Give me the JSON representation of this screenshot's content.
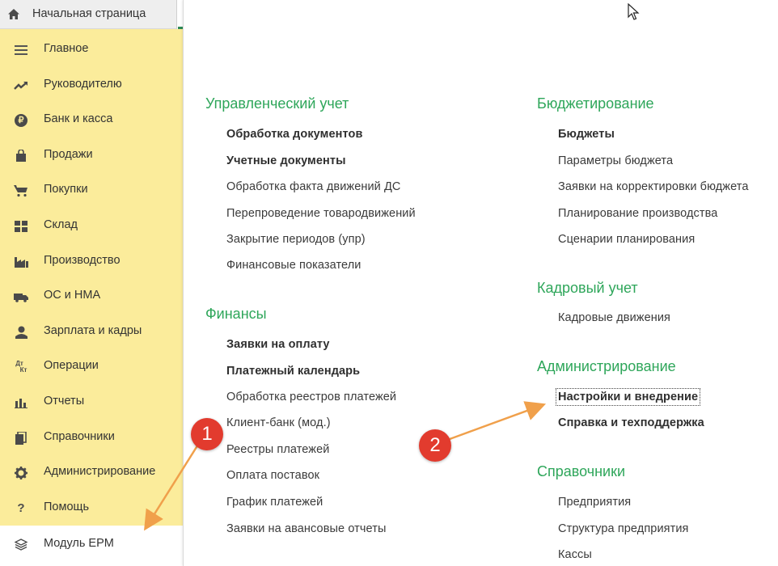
{
  "header": {
    "home_tab_label": "Начальная страница"
  },
  "sidebar": {
    "items": [
      {
        "label": "Главное",
        "icon": "menu-lines-icon"
      },
      {
        "label": "Руководителю",
        "icon": "trend-up-icon"
      },
      {
        "label": "Банк и касса",
        "icon": "ruble-coin-icon"
      },
      {
        "label": "Продажи",
        "icon": "shopping-bag-icon"
      },
      {
        "label": "Покупки",
        "icon": "cart-icon"
      },
      {
        "label": "Склад",
        "icon": "warehouse-grid-icon"
      },
      {
        "label": "Производство",
        "icon": "factory-icon"
      },
      {
        "label": "ОС и НМА",
        "icon": "truck-icon"
      },
      {
        "label": "Зарплата и кадры",
        "icon": "person-icon"
      },
      {
        "label": "Операции",
        "icon": "debit-credit-icon"
      },
      {
        "label": "Отчеты",
        "icon": "bar-chart-icon"
      },
      {
        "label": "Справочники",
        "icon": "books-icon"
      },
      {
        "label": "Администрирование",
        "icon": "gear-icon"
      },
      {
        "label": "Помощь",
        "icon": "question-icon"
      },
      {
        "label": "Модуль EPM",
        "icon": "cube-stack-icon"
      }
    ],
    "icon_text": {
      "ruble": "₽",
      "debit_credit_top": "Дт",
      "debit_credit_bottom": "Кт",
      "question": "?"
    }
  },
  "panel": {
    "left": [
      {
        "title": "Управленческий учет",
        "links": [
          {
            "label": "Обработка документов",
            "bold": true
          },
          {
            "label": "Учетные документы",
            "bold": true
          },
          {
            "label": "Обработка факта движений ДС",
            "bold": false
          },
          {
            "label": "Перепроведение товародвижений",
            "bold": false
          },
          {
            "label": "Закрытие периодов (упр)",
            "bold": false
          },
          {
            "label": "Финансовые показатели",
            "bold": false
          }
        ]
      },
      {
        "title": "Финансы",
        "links": [
          {
            "label": "Заявки на оплату",
            "bold": true
          },
          {
            "label": "Платежный календарь",
            "bold": true
          },
          {
            "label": "Обработка реестров платежей",
            "bold": false
          },
          {
            "label": "Клиент-банк (мод.)",
            "bold": false
          },
          {
            "label": "Реестры платежей",
            "bold": false
          },
          {
            "label": "Оплата поставок",
            "bold": false
          },
          {
            "label": "График платежей",
            "bold": false
          },
          {
            "label": "Заявки на авансовые отчеты",
            "bold": false
          }
        ]
      }
    ],
    "right": [
      {
        "title": "Бюджетирование",
        "links": [
          {
            "label": "Бюджеты",
            "bold": true
          },
          {
            "label": "Параметры бюджета",
            "bold": false
          },
          {
            "label": "Заявки на корректировки бюджета",
            "bold": false
          },
          {
            "label": "Планирование производства",
            "bold": false
          },
          {
            "label": "Сценарии планирования",
            "bold": false
          }
        ]
      },
      {
        "title": "Кадровый учет",
        "links": [
          {
            "label": "Кадровые движения",
            "bold": false
          }
        ]
      },
      {
        "title": "Администрирование",
        "links": [
          {
            "label": "Настройки и внедрение",
            "bold": true,
            "focused": true
          },
          {
            "label": "Справка и техподдержка",
            "bold": true
          }
        ]
      },
      {
        "title": "Справочники",
        "links": [
          {
            "label": "Предприятия",
            "bold": false
          },
          {
            "label": "Структура предприятия",
            "bold": false
          },
          {
            "label": "Кассы",
            "bold": false
          }
        ]
      }
    ]
  },
  "annotations": {
    "badge1": "1",
    "badge2": "2",
    "color": "#e23b2e",
    "arrow_color": "#f0a04b"
  },
  "colors": {
    "sidebar_bg": "#fbec9b",
    "section_title": "#2ea65a"
  }
}
